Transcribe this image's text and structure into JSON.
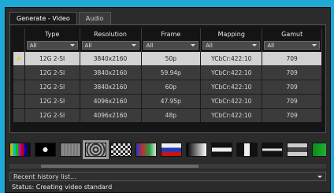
{
  "tabs": [
    {
      "label": "Generate - Video",
      "active": true
    },
    {
      "label": "Audio",
      "active": false
    }
  ],
  "table": {
    "columns": [
      "",
      "Type",
      "Resolution",
      "Frame",
      "Mapping",
      "Gamut"
    ],
    "filters": [
      "",
      "All",
      "All",
      "All",
      "All",
      "All"
    ],
    "rows": [
      {
        "mark": "★",
        "type": "12G 2-SI",
        "resolution": "3840x2160",
        "frame": "50p",
        "mapping": "YCbCr:422:10",
        "gamut": "709",
        "selected": true
      },
      {
        "mark": "",
        "type": "12G 2-SI",
        "resolution": "3840x2160",
        "frame": "59.94p",
        "mapping": "YCbCr:422:10",
        "gamut": "709",
        "selected": false
      },
      {
        "mark": "",
        "type": "12G 2-SI",
        "resolution": "3840x2160",
        "frame": "60p",
        "mapping": "YCbCr:422:10",
        "gamut": "709",
        "selected": false
      },
      {
        "mark": "",
        "type": "12G 2-SI",
        "resolution": "4096x2160",
        "frame": "47.95p",
        "mapping": "YCbCr:422:10",
        "gamut": "709",
        "selected": false
      },
      {
        "mark": "",
        "type": "12G 2-SI",
        "resolution": "4096x2160",
        "frame": "48p",
        "mapping": "YCbCr:422:10",
        "gamut": "709",
        "selected": false
      }
    ]
  },
  "thumbnails": [
    {
      "name": "color-bars-thumbnail",
      "bg": "linear-gradient(90deg,#c0c000 0 14%,#00c0c0 14% 28%,#00c000 28% 42%,#c000c0 42% 56%,#c00000 56% 70%,#0000c0 70% 84%,#111 84%)",
      "selected": false
    },
    {
      "name": "pluge-thumbnail",
      "bg": "radial-gradient(circle at 50% 50%,#eee 0 3px,#000 3px)",
      "selected": false
    },
    {
      "name": "grey-field-thumbnail",
      "bg": "repeating-linear-gradient(90deg,#777 0 2px,#8a8a8a 2px 4px)",
      "selected": false
    },
    {
      "name": "zone-plate-thumbnail",
      "bg": "repeating-radial-gradient(circle,#aaa 0 2px,#333 2px 4px)",
      "selected": true
    },
    {
      "name": "checkerboard-thumbnail",
      "bg": "repeating-conic-gradient(#ddd 0 25%,#222 0 50%) 0 0/6px 6px",
      "selected": false
    },
    {
      "name": "color-mix-thumbnail",
      "bg": "linear-gradient(90deg,#2040c0,#c03030,#20a040,#e0e0e0)",
      "selected": false
    },
    {
      "name": "flag-stripes-thumbnail",
      "bg": "linear-gradient(180deg,#eee 0 33%,#1a3cc0 33% 66%,#c01818 66%)",
      "selected": false
    },
    {
      "name": "grey-ramp-thumbnail",
      "bg": "linear-gradient(90deg,#000,#fff)",
      "selected": false
    },
    {
      "name": "white-band-thumbnail",
      "bg": "linear-gradient(180deg,#111 0 35%,#eee 35% 65%,#111 65%)",
      "selected": false
    },
    {
      "name": "window-thumbnail",
      "bg": "linear-gradient(90deg,#111 0 35%,#eee 35% 65%,#111 65%)",
      "selected": false
    },
    {
      "name": "white-bar-thumbnail",
      "bg": "linear-gradient(180deg,#111 0 40%,#ddd 40% 60%,#111 60%)",
      "selected": false
    },
    {
      "name": "split-field-thumbnail",
      "bg": "linear-gradient(180deg,#ccc 0 30%,#444 30% 70%,#ccc 70%)",
      "selected": false
    },
    {
      "name": "green-field-thumbnail",
      "bg": "linear-gradient(90deg,#0a8a1a,#30c040)",
      "selected": false
    }
  ],
  "history": {
    "label": "Recent history list..."
  },
  "status": {
    "text": "Status: Creating video standard"
  }
}
